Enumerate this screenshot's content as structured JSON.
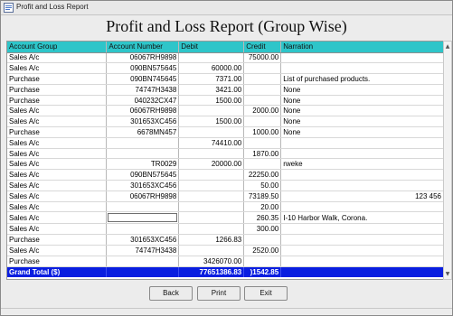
{
  "window": {
    "title": "Profit and Loss Report"
  },
  "report": {
    "title": "Profit and Loss Report (Group Wise)"
  },
  "table": {
    "columns": [
      "Account Group",
      "Account Number",
      "Debit",
      "Credit",
      "Narration"
    ],
    "rows": [
      [
        "Sales A/c",
        "06067RH9898",
        "",
        "75000.00",
        ""
      ],
      [
        "Sales A/c",
        "090BN575645",
        "60000.00",
        "",
        ""
      ],
      [
        "Purchase",
        "090BN745645",
        "7371.00",
        "",
        "List of purchased products."
      ],
      [
        "Purchase",
        "74747H3438",
        "3421.00",
        "",
        "None"
      ],
      [
        "Purchase",
        "040232CX47",
        "1500.00",
        "",
        "None"
      ],
      [
        "Sales A/c",
        "06067RH9898",
        "",
        "2000.00",
        "None"
      ],
      [
        "Sales A/c",
        "301653XC456",
        "1500.00",
        "",
        "None"
      ],
      [
        "Purchase",
        "6678MN457",
        "",
        "1000.00",
        "None"
      ],
      [
        "Sales A/c",
        "",
        "74410.00",
        "",
        ""
      ],
      [
        "Sales A/c",
        "",
        "",
        "1870.00",
        ""
      ],
      [
        "Sales A/c",
        "TR0029",
        "20000.00",
        "",
        "rweke"
      ],
      [
        "Sales A/c",
        "090BN575645",
        "",
        "22250.00",
        ""
      ],
      [
        "Sales A/c",
        "301653XC456",
        "",
        "50.00",
        ""
      ],
      [
        "Sales A/c",
        "06067RH9898",
        "",
        "73189.50",
        "123 456"
      ],
      [
        "Sales A/c",
        "",
        "",
        "20.00",
        ""
      ],
      [
        "Sales A/c",
        "",
        "",
        "260.35",
        "I-10 Harbor Walk, Corona."
      ],
      [
        "Sales A/c",
        "",
        "",
        "300.00",
        ""
      ],
      [
        "Purchase",
        "301653XC456",
        "1266.83",
        "",
        ""
      ],
      [
        "Sales A/c",
        "74747H3438",
        "",
        "2520.00",
        ""
      ],
      [
        "Purchase",
        "",
        "3426070.00",
        "",
        ""
      ]
    ],
    "total": {
      "label": "Grand Total ($)",
      "debit": "77651386.83",
      "credit": ")1542.85"
    }
  },
  "buttons": {
    "back": "Back",
    "print": "Print",
    "exit": "Exit"
  },
  "colors": {
    "header_bg": "#2ec5c9",
    "total_bg": "#0a1ee0"
  },
  "icons": {
    "window": "report-window-icon"
  }
}
